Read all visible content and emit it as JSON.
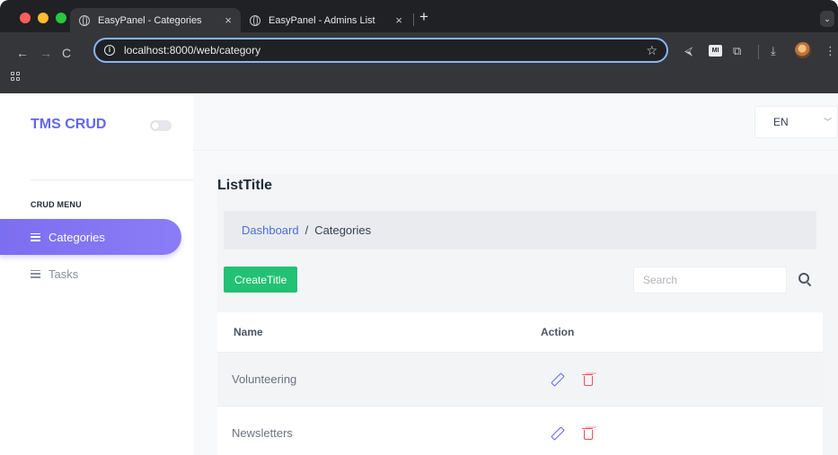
{
  "browser": {
    "tabs": [
      {
        "title": "EasyPanel - Categories",
        "active": true
      },
      {
        "title": "EasyPanel - Admins List",
        "active": false
      }
    ],
    "tab_close_glyph": "×",
    "new_tab_glyph": "+",
    "tab_menu_glyph": "⌄",
    "url": "localhost:8000/web/category",
    "icons": {
      "back": "←",
      "forward": "→",
      "reload": "C",
      "info": "i",
      "star": "☆",
      "extension_bird": "⮘",
      "extension_mi": "MI",
      "extension_puzzle": "⧉",
      "download": "⤓",
      "more": "⋮"
    },
    "colors": {
      "frame": "#202124",
      "toolbar": "#35363a",
      "omnibox_focus": "#8ab4f8"
    }
  },
  "sidebar": {
    "brand": "TMS CRUD",
    "menu_heading": "CRUD MENU",
    "items": [
      {
        "label": "Categories",
        "active": true
      },
      {
        "label": "Tasks",
        "active": false
      }
    ],
    "colors": {
      "brand": "#6366f1",
      "active_gradient_start": "#7c6ef0",
      "active_gradient_end": "#8b7cf6"
    }
  },
  "topbar": {
    "language": "EN",
    "language_chevron": "﹀"
  },
  "main": {
    "title": "ListTitle",
    "breadcrumb": {
      "home": "Dashboard",
      "separator": "/",
      "current": "Categories"
    },
    "create_label": "CreateTitle",
    "search": {
      "placeholder": "Search",
      "value": ""
    },
    "table": {
      "columns": [
        "Name",
        "Action"
      ],
      "rows": [
        {
          "name": "Volunteering"
        },
        {
          "name": "Newsletters"
        }
      ]
    },
    "colors": {
      "create_button": "#22c173",
      "edit_icon": "#6366f1",
      "delete_icon": "#ef4b5c",
      "breadcrumb_link": "#4f6bdc"
    }
  }
}
